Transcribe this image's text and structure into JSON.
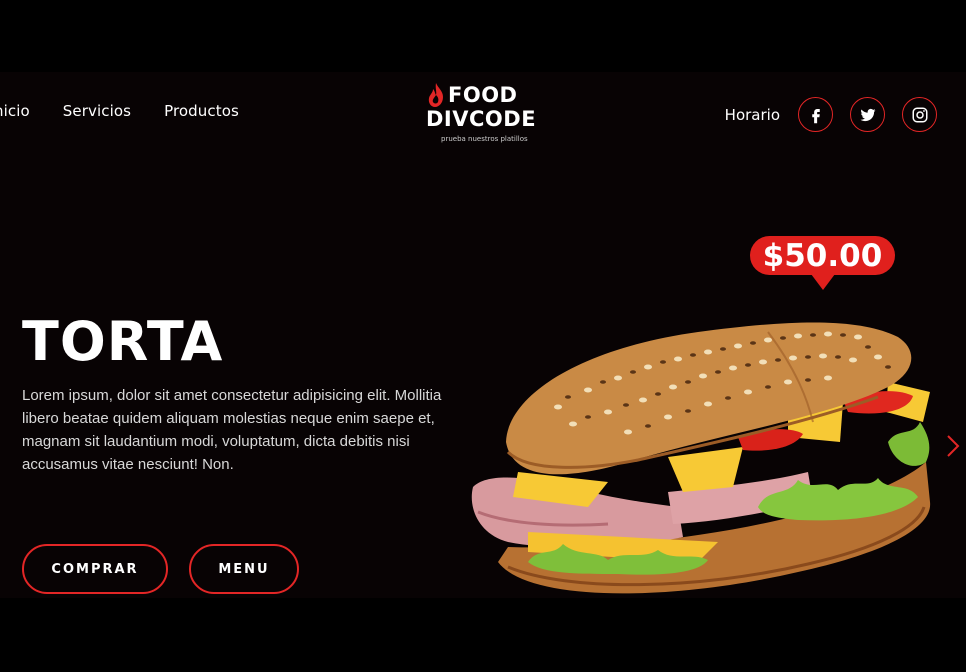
{
  "nav": {
    "left_links": [
      "nicio",
      "Servicios",
      "Productos"
    ],
    "schedule_label": "Horario",
    "social": [
      "facebook-icon",
      "twitter-icon",
      "instagram-icon"
    ]
  },
  "logo": {
    "line1": "FOOD",
    "line2": "DIVCODE",
    "tagline": "prueba nuestros platillos"
  },
  "hero": {
    "title": "TORTA",
    "description": "Lorem ipsum, dolor sit amet consectetur adipisicing elit. Mollitia libero beatae quidem aliquam molestias neque enim saepe et, magnam sit laudantium modi, voluptatum, dicta debitis nisi accusamus vitae nesciunt! Non.",
    "buy_label": "COMPRAR",
    "menu_label": "MENU",
    "price": "$50.00"
  },
  "colors": {
    "accent": "#e32626",
    "background": "#080304",
    "outer": "#000000"
  }
}
